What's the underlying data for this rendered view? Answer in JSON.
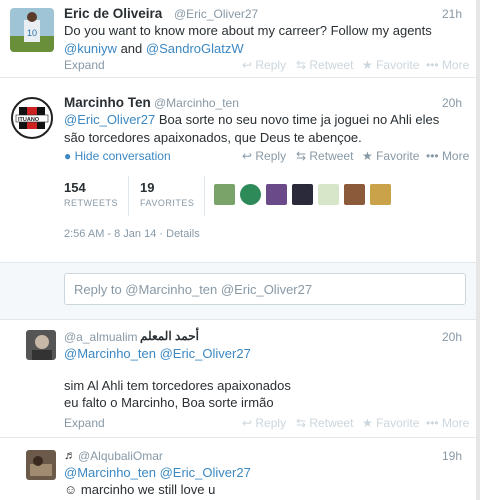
{
  "tweet1": {
    "name": "Eric de Oliveira",
    "handle": "@Eric_Oliver27",
    "time": "21h",
    "line1": "Do you want to know more about my carreer? Follow my agents",
    "mention1": "@kuniyw",
    "and": "and",
    "mention2": "@SandroGlatzW",
    "expand": "Expand",
    "reply": "Reply",
    "retweet": "Retweet",
    "favorite": "Favorite",
    "more": "More"
  },
  "tweet2": {
    "name": "Marcinho Ten",
    "handle": "@Marcinho_ten",
    "time": "20h",
    "mention": "@Eric_Oliver27",
    "line1": " Boa sorte no seu novo time ja joguei no Ahli eles",
    "line2": "são torcedores apaixonados, que Deus te abençoe.",
    "hide": "Hide conversation",
    "reply": "Reply",
    "retweet": "Retweet",
    "favorite": "Favorite",
    "more": "More",
    "retweets_count": "154",
    "retweets_label": "RETWEETS",
    "favorites_count": "19",
    "favorites_label": "FAVORITES",
    "date": "2:56 AM - 8 Jan 14",
    "details": "Details"
  },
  "reply_box": {
    "placeholder": "Reply to @Marcinho_ten @Eric_Oliver27"
  },
  "tweet3": {
    "handle": "@a_almualim",
    "name": "أحمد المعلم",
    "time": "20h",
    "mention1": "@Marcinho_ten",
    "mention2": "@Eric_Oliver27",
    "line1": "sim Al Ahli tem torcedores apaixonados",
    "line2": "eu falto o Marcinho, Boa sorte irmão",
    "expand": "Expand",
    "reply": "Reply",
    "retweet": "Retweet",
    "favorite": "Favorite",
    "more": "More"
  },
  "tweet4": {
    "name_prefix": "♬",
    "handle": "@AlqubaliOmar",
    "time": "19h",
    "mention1": "@Marcinho_ten",
    "mention2": "@Eric_Oliver27",
    "line1": "marcinho we still love u"
  },
  "colors": {
    "link": "#3b88c3",
    "muted": "#8899a6",
    "faint": "#ccd6dd"
  }
}
